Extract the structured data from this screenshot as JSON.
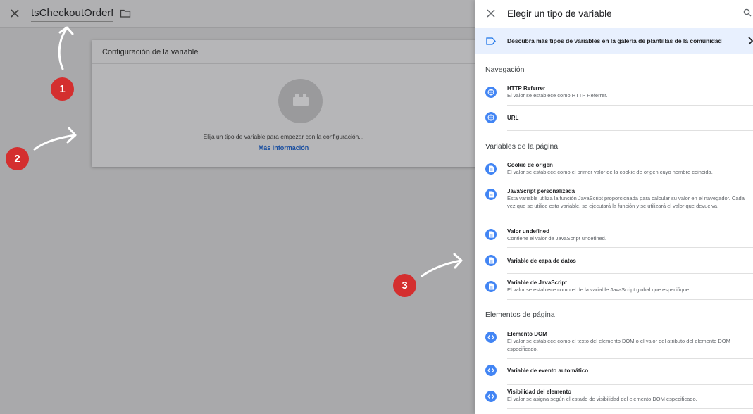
{
  "editor": {
    "variable_name": "tsCheckoutOrderNr",
    "card_title": "Configuración de la variable",
    "card_text": "Elija un tipo de variable para empezar con la configuración...",
    "more_link": "Más información"
  },
  "annotations": [
    "1",
    "2",
    "3"
  ],
  "panel": {
    "title": "Elegir un tipo de variable",
    "gallery_banner": "Descubra más tipos de variables en la galería de plantillas de la comunidad",
    "sections": [
      {
        "title": "Navegación",
        "items": [
          {
            "name": "HTTP Referrer",
            "desc": "El valor se establece como HTTP Referrer.",
            "icon": "globe-icon"
          },
          {
            "name": "URL",
            "desc": "",
            "icon": "globe-icon"
          }
        ]
      },
      {
        "title": "Variables de la página",
        "items": [
          {
            "name": "Cookie de origen",
            "desc": "El valor se establece como el primer valor de la cookie de origen cuyo nombre coincida.",
            "icon": "document-icon"
          },
          {
            "name": "JavaScript personalizada",
            "desc": "Esta variable utiliza la función JavaScript proporcionada para calcular su valor en el navegador. Cada vez que se utilice esta variable, se ejecutará la función y se utilizará el valor que devuelva.",
            "icon": "document-icon"
          },
          {
            "name": "Valor undefined",
            "desc": "Contiene el valor de JavaScript undefined.",
            "icon": "document-icon"
          },
          {
            "name": "Variable de capa de datos",
            "desc": "",
            "icon": "document-icon"
          },
          {
            "name": "Variable de JavaScript",
            "desc": "El valor se establece como el de la variable JavaScript global que especifique.",
            "icon": "document-icon"
          }
        ]
      },
      {
        "title": "Elementos de página",
        "items": [
          {
            "name": "Elemento DOM",
            "desc": "El valor se establece como el texto del elemento DOM o el valor del atributo del elemento DOM especificado.",
            "icon": "code-icon"
          },
          {
            "name": "Variable de evento automático",
            "desc": "",
            "icon": "code-icon"
          },
          {
            "name": "Visibilidad del elemento",
            "desc": "El valor se asigna según el estado de visibilidad del elemento DOM especificado.",
            "icon": "code-icon"
          }
        ]
      }
    ]
  }
}
